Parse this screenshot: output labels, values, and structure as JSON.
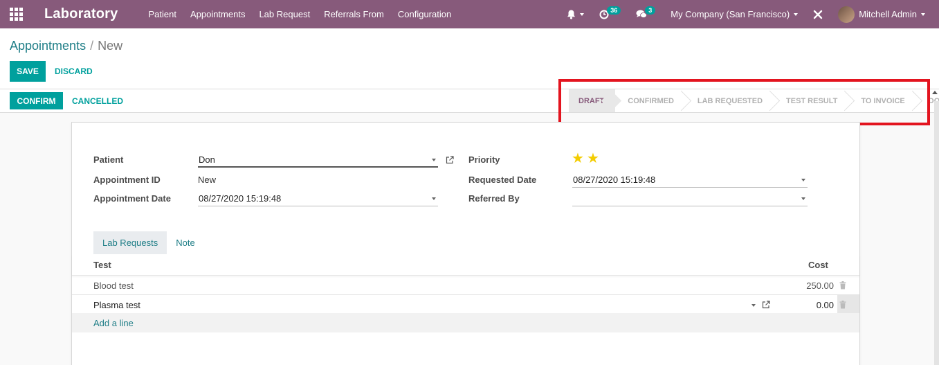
{
  "navbar": {
    "brand": "Laboratory",
    "menu": [
      "Patient",
      "Appointments",
      "Lab Request",
      "Referrals From",
      "Configuration"
    ],
    "activity_count": "36",
    "message_count": "3",
    "company": "My Company (San Francisco)",
    "user": "Mitchell Admin"
  },
  "breadcrumb": {
    "parent": "Appointments",
    "separator": "/",
    "current": "New"
  },
  "actions": {
    "save": "SAVE",
    "discard": "DISCARD",
    "confirm": "CONFIRM",
    "cancelled": "CANCELLED"
  },
  "stages": [
    "DRAFT",
    "CONFIRMED",
    "LAB REQUESTED",
    "TEST RESULT",
    "TO INVOICE",
    "DONE"
  ],
  "active_stage": "DRAFT",
  "form": {
    "patient_label": "Patient",
    "patient_value": "Don",
    "appointment_id_label": "Appointment ID",
    "appointment_id_value": "New",
    "appointment_date_label": "Appointment Date",
    "appointment_date_value": "08/27/2020 15:19:48",
    "priority_label": "Priority",
    "priority_stars": 2,
    "requested_date_label": "Requested Date",
    "requested_date_value": "08/27/2020 15:19:48",
    "referred_by_label": "Referred By",
    "referred_by_value": ""
  },
  "tabs": [
    "Lab Requests",
    "Note"
  ],
  "table": {
    "headers": {
      "test": "Test",
      "cost": "Cost"
    },
    "rows": [
      {
        "test": "Blood test",
        "cost": "250.00"
      },
      {
        "test": "Plasma test",
        "cost": "0.00"
      }
    ],
    "add_line": "Add a line"
  },
  "colors": {
    "brand": "#875a7b",
    "accent": "#00a09d",
    "highlight": "#e3141f",
    "star": "#f3cc00"
  }
}
